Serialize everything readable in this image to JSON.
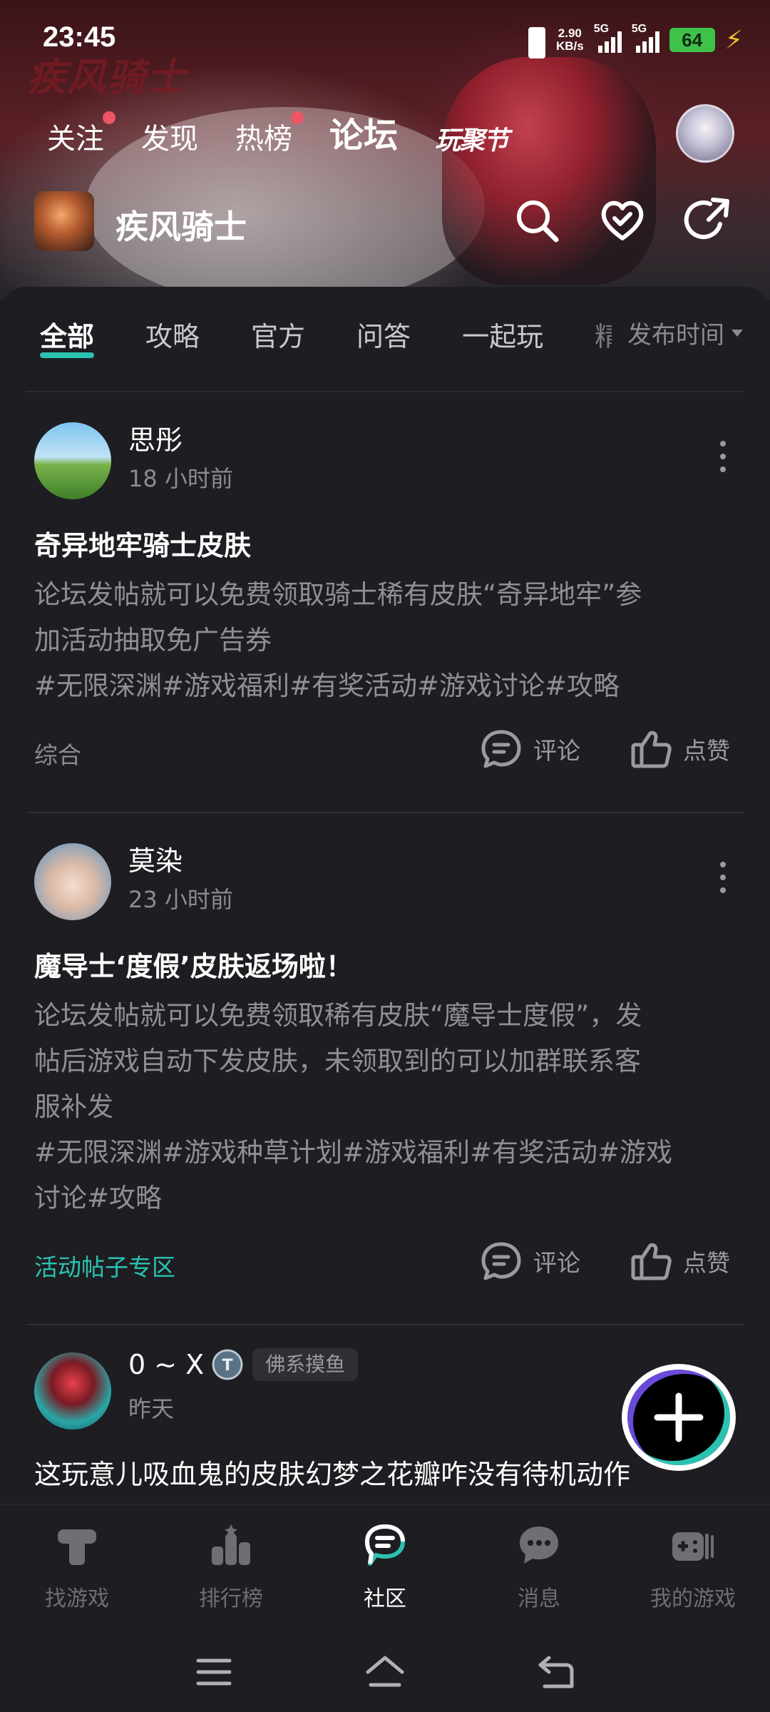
{
  "status_bar": {
    "time": "23:45",
    "net_speed_value": "2.90",
    "net_speed_unit": "KB/s",
    "signal1_label": "5G",
    "signal2_label": "5G",
    "battery": "64"
  },
  "banner": {
    "logo_text": "疾风骑士"
  },
  "top_tabs": [
    {
      "label": "关注",
      "has_dot": true
    },
    {
      "label": "发现",
      "has_dot": false
    },
    {
      "label": "热榜",
      "has_dot": true
    },
    {
      "label": "论坛",
      "active": true
    },
    {
      "label": "玩聚节"
    }
  ],
  "game": {
    "name": "疾风骑士"
  },
  "header_icons": [
    "search-icon",
    "heart-check-icon",
    "share-icon"
  ],
  "sub_tabs": [
    {
      "label": "全部",
      "active": true
    },
    {
      "label": "攻略"
    },
    {
      "label": "官方"
    },
    {
      "label": "问答"
    },
    {
      "label": "一起玩"
    },
    {
      "label": "精"
    }
  ],
  "sort": {
    "label": "发布时间"
  },
  "posts": [
    {
      "author": "思彤",
      "time": "18 小时前",
      "title": "奇异地牢骑士皮肤",
      "body_lines": [
        "论坛发帖就可以免费领取骑士稀有皮肤“奇异地牢”参",
        "加活动抽取免广告券",
        "#无限深渊#游戏福利#有奖活动#游戏讨论#攻略"
      ],
      "category": "综合",
      "comment_label": "评论",
      "like_label": "点赞"
    },
    {
      "author": "莫染",
      "time": "23 小时前",
      "title": "魔导士‘度假’皮肤返场啦！",
      "body_lines": [
        "论坛发帖就可以免费领取稀有皮肤“魔导士度假”，发",
        "帖后游戏自动下发皮肤，未领取到的可以加群联系客",
        "服补发",
        "#无限深渊#游戏种草计划#游戏福利#有奖活动#游戏",
        "讨论#攻略"
      ],
      "category": "活动帖子专区",
      "comment_label": "评论",
      "like_label": "点赞"
    },
    {
      "author": "0 ~ X",
      "badge": "佛系摸鱼",
      "time": "昨天",
      "title": "这玩意儿吸血鬼的皮肤幻梦之花瓣咋没有待机动作"
    }
  ],
  "bottom_nav": [
    {
      "label": "找游戏",
      "icon": "find-game-icon"
    },
    {
      "label": "排行榜",
      "icon": "ranking-icon"
    },
    {
      "label": "社区",
      "icon": "community-icon",
      "active": true
    },
    {
      "label": "消息",
      "icon": "message-icon"
    },
    {
      "label": "我的游戏",
      "icon": "my-games-icon"
    }
  ],
  "colors": {
    "accent": "#2bc2b1",
    "background": "#1d1d22",
    "dot": "#ee5567",
    "battery": "#3fc24a"
  }
}
